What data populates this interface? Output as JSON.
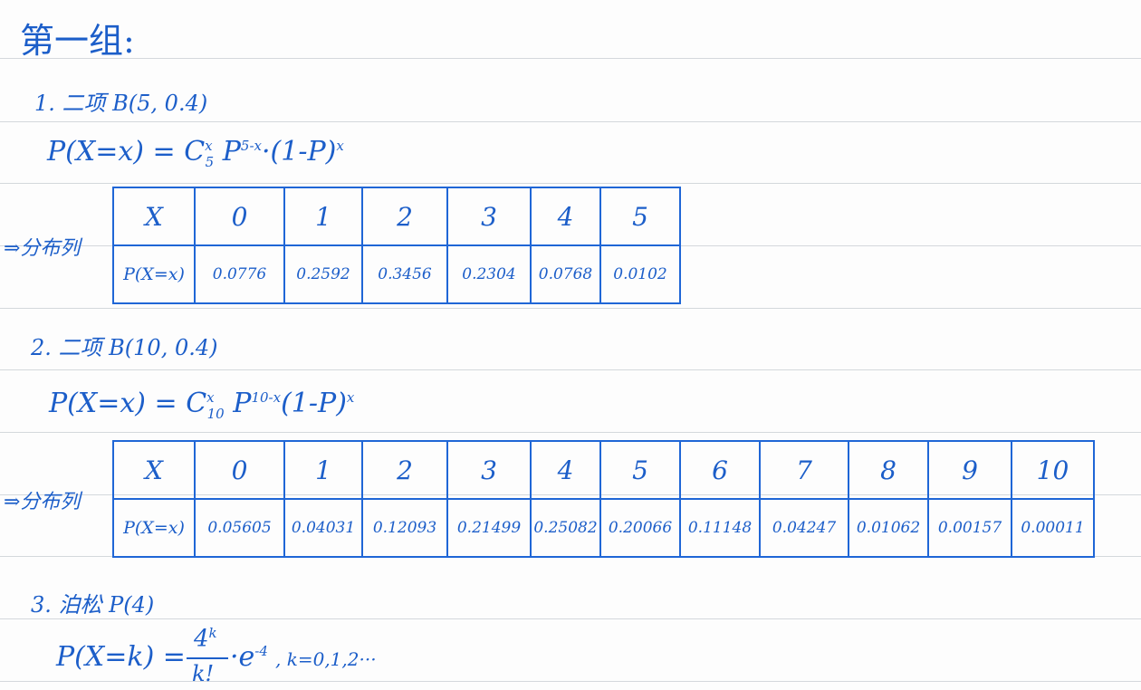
{
  "title": "第一组:",
  "sections": [
    {
      "heading": "1. 二项 B(5, 0.4)",
      "formula": {
        "base": "P(X=x) = C",
        "sup1": "x",
        "sub1": "5",
        "p": "P",
        "sup2": "5-x",
        "mid": "·(1-P)",
        "sup3": "x"
      },
      "label": "⇒分布列",
      "table": {
        "x_header": "X",
        "p_header": "P(X=x)",
        "x": [
          "0",
          "1",
          "2",
          "3",
          "4",
          "5"
        ],
        "p": [
          "0.0776",
          "0.2592",
          "0.3456",
          "0.2304",
          "0.0768",
          "0.0102"
        ]
      }
    },
    {
      "heading": "2. 二项 B(10, 0.4)",
      "formula": {
        "base": "P(X=x) = C",
        "sup1": "x",
        "sub1": "10",
        "p": "P",
        "sup2": "10-x",
        "mid": "(1-P)",
        "sup3": "x"
      },
      "label": "⇒分布列",
      "table": {
        "x_header": "X",
        "p_header": "P(X=x)",
        "x": [
          "0",
          "1",
          "2",
          "3",
          "4",
          "5",
          "6",
          "7",
          "8",
          "9",
          "10"
        ],
        "p": [
          "0.05605",
          "0.04031",
          "0.12093",
          "0.21499",
          "0.25082",
          "0.20066",
          "0.11148",
          "0.04247",
          "0.01062",
          "0.00157",
          "0.00011"
        ]
      }
    },
    {
      "heading": "3. 泊松 P(4)",
      "formula": {
        "lhs": "P(X=k) =",
        "num": "4",
        "num_sup": "k",
        "den": "k!",
        "exp": "·e",
        "exp_sup": "-4",
        "tail": ", k=0,1,2···"
      }
    }
  ]
}
